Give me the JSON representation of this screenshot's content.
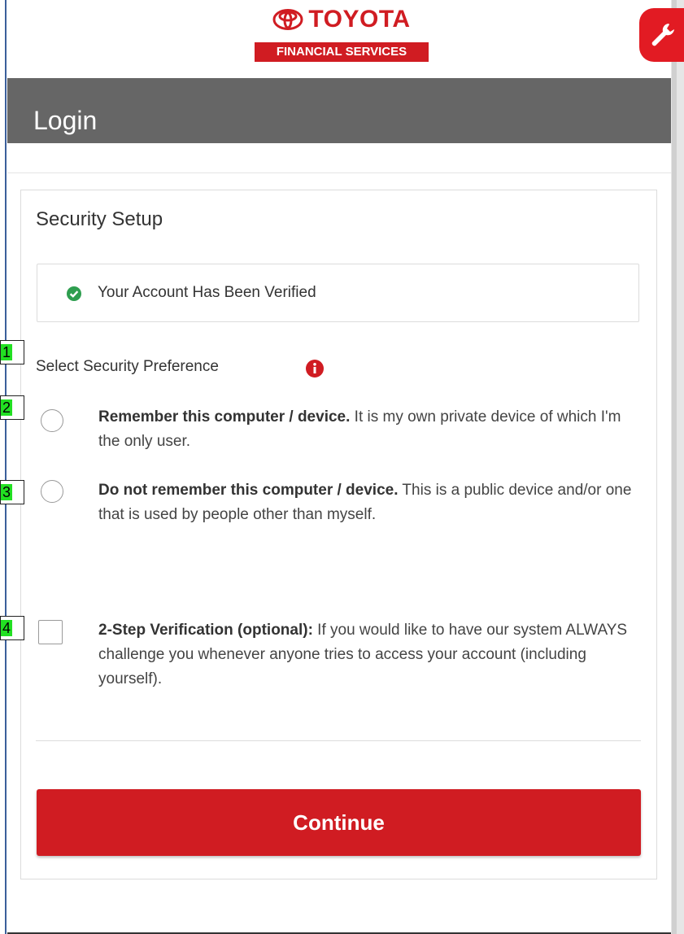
{
  "brand": {
    "name": "TOYOTA",
    "subtitle": "FINANCIAL SERVICES",
    "color": "#d01c22"
  },
  "header": {
    "title": "Login"
  },
  "card": {
    "title": "Security Setup",
    "verified_message": "Your Account Has Been Verified",
    "preference_label": "Select Security Preference",
    "options": [
      {
        "bold": "Remember this computer / device.",
        "text": " It is my own private device of which I'm the only user.",
        "selected": false
      },
      {
        "bold": "Do not remember this computer / device.",
        "text": " This is a public device and/or one that is used by people other than myself.",
        "selected": false
      }
    ],
    "two_step": {
      "bold": "2-Step Verification (optional):",
      "text": " If you would like to have our system ALWAYS challenge you whenever anyone tries to access your account (including yourself).",
      "checked": false
    },
    "continue_label": "Continue"
  },
  "markers": [
    "1",
    "2",
    "3",
    "4"
  ],
  "icons": {
    "tool": "wrench-icon",
    "verified": "check-circle-icon",
    "info": "info-icon"
  },
  "colors": {
    "accent": "#d01c22",
    "header_bg": "#666666",
    "success": "#2e9e4f"
  }
}
